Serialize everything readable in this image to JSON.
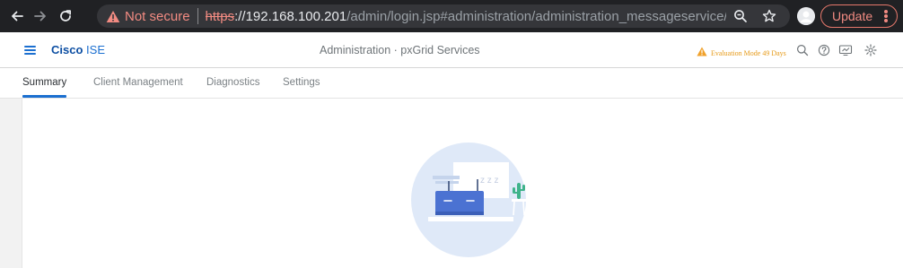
{
  "browser": {
    "security_label": "Not secure",
    "url_scheme": "https",
    "url_host": "://192.168.100.201",
    "url_path": "/admin/login.jsp#administration/administration_messageservice/pxgrid...",
    "update_label": "Update",
    "icons": [
      "back-arrow-icon",
      "forward-arrow-icon",
      "reload-icon",
      "warning-icon",
      "zoom-icon",
      "star-icon",
      "profile-avatar",
      "more-vertical-icon"
    ]
  },
  "app": {
    "brand_cisco": "Cisco",
    "brand_product": "ISE",
    "page_title": "Administration · pxGrid Services",
    "evaluation_text": "Evaluation Mode 49 Days",
    "icons": [
      "menu-icon",
      "warning-icon",
      "search-icon",
      "help-icon",
      "monitor-icon",
      "gear-icon"
    ]
  },
  "tabs": [
    {
      "label": "Summary",
      "active": true
    },
    {
      "label": "Client Management",
      "active": false
    },
    {
      "label": "Diagnostics",
      "active": false
    },
    {
      "label": "Settings",
      "active": false
    }
  ],
  "main": {
    "illustration": "sleeping-router-empty-state",
    "illustration_text": "z z z"
  },
  "colors": {
    "chrome_bg": "#202124",
    "omnibox_bg": "#35363a",
    "accent": "#1b6fd0",
    "brand_dark": "#0d4fa3",
    "warning": "#e69a18",
    "not_secure": "#f28b82"
  }
}
